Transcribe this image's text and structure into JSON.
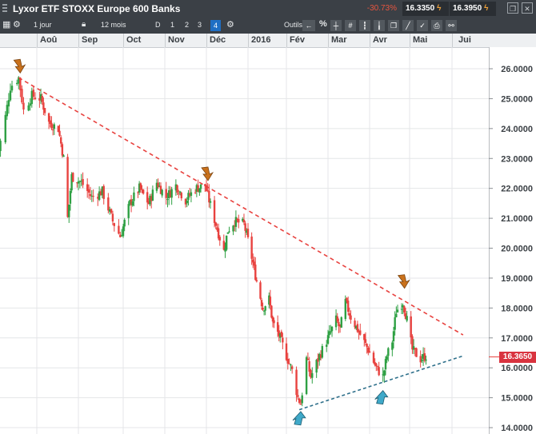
{
  "window": {
    "title": "Lyxor ETF STOXX Europe 600 Banks",
    "change_pct": "-30.73%",
    "bid": "16.3350",
    "ask": "16.3950"
  },
  "toolbar": {
    "interval": "1 jour",
    "range": "12 mois",
    "periods": [
      "D",
      "1",
      "2",
      "3",
      "4"
    ],
    "active_period": "4",
    "tools_label": "Outils"
  },
  "colors": {
    "up": "#2ea043",
    "down": "#e8423f",
    "resistance": "#e8423f",
    "support": "#2d6f8a",
    "accent": "#1f6fc4"
  },
  "chart_data": {
    "type": "candlestick",
    "x_ticks": [
      "Aoû",
      "Sep",
      "Oct",
      "Nov",
      "Déc",
      "2016",
      "Fév",
      "Mar",
      "Avr",
      "Mai",
      "Jui"
    ],
    "y_ticks": [
      "26.0000",
      "25.0000",
      "24.0000",
      "23.0000",
      "22.0000",
      "21.0000",
      "20.0000",
      "19.0000",
      "18.0000",
      "17.0000",
      "16.0000",
      "15.0000",
      "14.0000"
    ],
    "ylim": [
      13.6,
      26.4
    ],
    "last_price_label": "16.3650",
    "last_price": 16.365,
    "price_path": [
      [
        "2015-07-08",
        23.0
      ],
      [
        "2015-07-13",
        24.4
      ],
      [
        "2015-07-16",
        25.4
      ],
      [
        "2015-07-21",
        25.7
      ],
      [
        "2015-07-24",
        24.6
      ],
      [
        "2015-07-29",
        25.1
      ],
      [
        "2015-08-04",
        25.0
      ],
      [
        "2015-08-10",
        24.2
      ],
      [
        "2015-08-17",
        24.0
      ],
      [
        "2015-08-21",
        23.0
      ],
      [
        "2015-08-24",
        21.0
      ],
      [
        "2015-08-27",
        22.4
      ],
      [
        "2015-09-03",
        22.2
      ],
      [
        "2015-09-10",
        21.7
      ],
      [
        "2015-09-17",
        21.9
      ],
      [
        "2015-09-24",
        20.9
      ],
      [
        "2015-09-29",
        20.4
      ],
      [
        "2015-10-06",
        21.5
      ],
      [
        "2015-10-13",
        22.0
      ],
      [
        "2015-10-20",
        21.5
      ],
      [
        "2015-10-26",
        22.2
      ],
      [
        "2015-11-02",
        21.7
      ],
      [
        "2015-11-09",
        22.1
      ],
      [
        "2015-11-16",
        21.6
      ],
      [
        "2015-11-23",
        22.0
      ],
      [
        "2015-11-30",
        22.1
      ],
      [
        "2015-12-03",
        21.6
      ],
      [
        "2015-12-08",
        20.8
      ],
      [
        "2015-12-14",
        19.9
      ],
      [
        "2015-12-17",
        20.6
      ],
      [
        "2015-12-22",
        20.9
      ],
      [
        "2015-12-29",
        20.8
      ],
      [
        "2016-01-04",
        19.7
      ],
      [
        "2016-01-08",
        18.9
      ],
      [
        "2016-01-13",
        18.0
      ],
      [
        "2016-01-18",
        18.3
      ],
      [
        "2016-01-21",
        17.5
      ],
      [
        "2016-01-26",
        17.1
      ],
      [
        "2016-02-01",
        16.4
      ],
      [
        "2016-02-05",
        15.9
      ],
      [
        "2016-02-09",
        15.0
      ],
      [
        "2016-02-11",
        14.8
      ],
      [
        "2016-02-15",
        16.3
      ],
      [
        "2016-02-18",
        15.7
      ],
      [
        "2016-02-24",
        16.4
      ],
      [
        "2016-03-01",
        17.0
      ],
      [
        "2016-03-07",
        17.6
      ],
      [
        "2016-03-10",
        17.3
      ],
      [
        "2016-03-14",
        18.2
      ],
      [
        "2016-03-18",
        17.7
      ],
      [
        "2016-03-24",
        17.2
      ],
      [
        "2016-03-31",
        16.6
      ],
      [
        "2016-04-06",
        16.0
      ],
      [
        "2016-04-11",
        15.7
      ],
      [
        "2016-04-14",
        16.4
      ],
      [
        "2016-04-18",
        16.9
      ],
      [
        "2016-04-21",
        17.9
      ],
      [
        "2016-04-26",
        18.2
      ],
      [
        "2016-04-29",
        17.6
      ],
      [
        "2016-05-03",
        16.6
      ],
      [
        "2016-05-09",
        16.3
      ],
      [
        "2016-05-13",
        16.4
      ]
    ],
    "trendlines": [
      {
        "name": "resistance",
        "from": [
          "2015-07-21",
          25.7
        ],
        "to": [
          "2016-06-09",
          17.1
        ]
      },
      {
        "name": "support",
        "from": [
          "2016-02-10",
          14.6
        ],
        "to": [
          "2016-06-09",
          16.4
        ]
      }
    ],
    "markers": [
      {
        "type": "top",
        "date": "2015-07-21",
        "price": 25.7
      },
      {
        "type": "top",
        "date": "2015-12-01",
        "price": 22.1
      },
      {
        "type": "top",
        "date": "2016-04-26",
        "price": 18.5
      },
      {
        "type": "bottom",
        "date": "2016-02-11",
        "price": 14.7
      },
      {
        "type": "bottom",
        "date": "2016-04-11",
        "price": 15.4
      }
    ]
  }
}
